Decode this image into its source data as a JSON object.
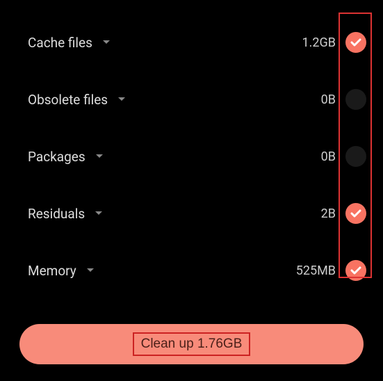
{
  "items": [
    {
      "label": "Cache files",
      "size": "1.2GB",
      "checked": true
    },
    {
      "label": "Obsolete files",
      "size": "0B",
      "checked": false
    },
    {
      "label": "Packages",
      "size": "0B",
      "checked": false
    },
    {
      "label": "Residuals",
      "size": "2B",
      "checked": true
    },
    {
      "label": "Memory",
      "size": "525MB",
      "checked": true
    }
  ],
  "button": {
    "label": "Clean up 1.76GB"
  }
}
